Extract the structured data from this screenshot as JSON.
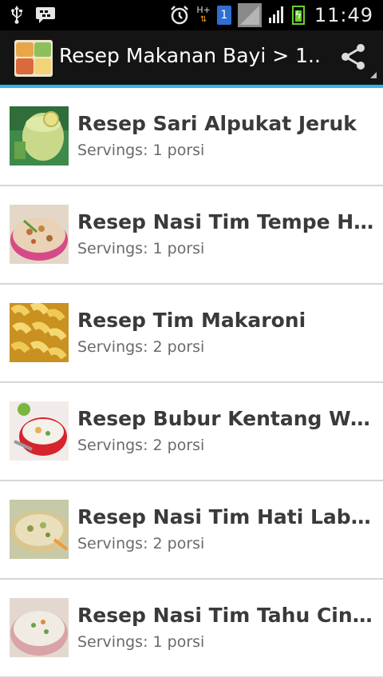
{
  "status_bar": {
    "time": "11:49",
    "sim_label": "1",
    "network_label": "H+"
  },
  "action_bar": {
    "title": "Resep Makanan Bayi > 1..."
  },
  "recipes": [
    {
      "title": "Resep Sari Alpukat Jeruk",
      "servings": "Servings: 1 porsi"
    },
    {
      "title": "Resep Nasi Tim Tempe Hati...",
      "servings": "Servings: 1 porsi"
    },
    {
      "title": "Resep Tim Makaroni",
      "servings": "Servings: 2 porsi"
    },
    {
      "title": "Resep Bubur Kentang Wortel",
      "servings": "Servings: 2 porsi"
    },
    {
      "title": "Resep Nasi Tim Hati Labu Ku...",
      "servings": "Servings: 2 porsi"
    },
    {
      "title": "Resep Nasi Tim Tahu Cincang",
      "servings": "Servings: 1 porsi"
    }
  ],
  "colors": {
    "accent": "#33b5e5",
    "action_bar_bg": "#141414",
    "divider": "#d6d6d6"
  }
}
